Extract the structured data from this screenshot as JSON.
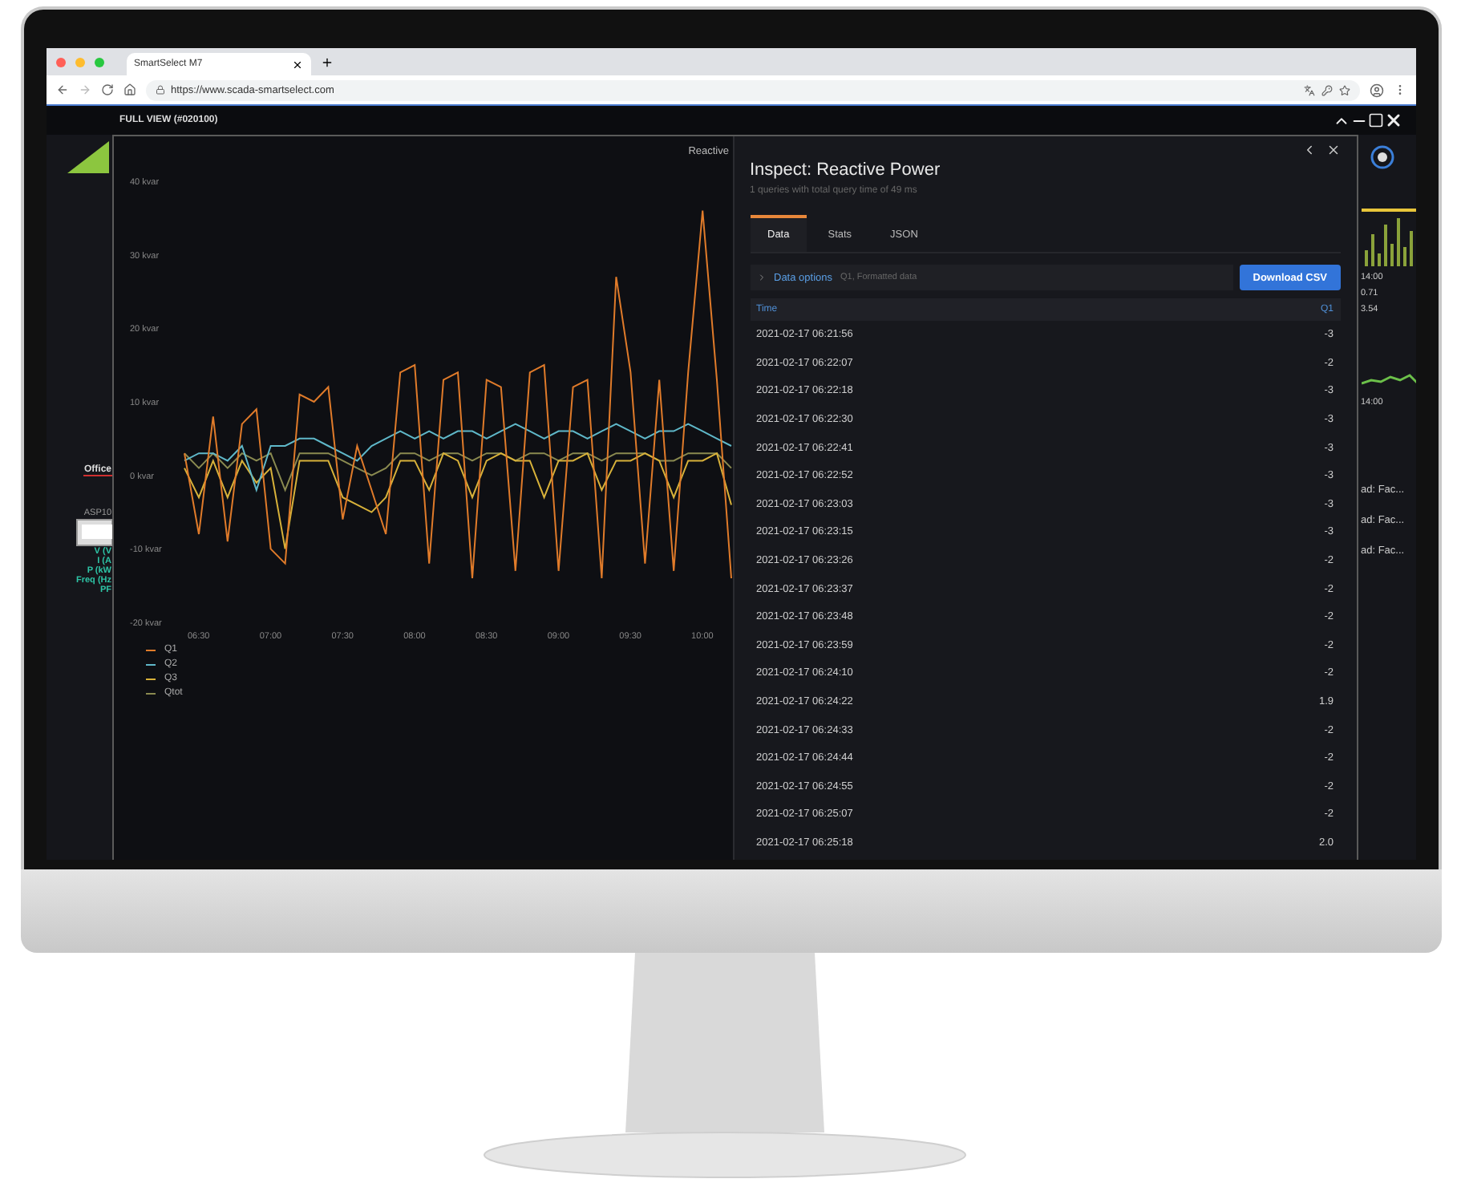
{
  "browser": {
    "tab_title": "SmartSelect M7",
    "url": "https://www.scada-smartselect.com"
  },
  "app_bar": {
    "title": "FULL VIEW (#020100)"
  },
  "left_fragments": {
    "nav_label": "Office",
    "device_label": "ASP10",
    "readings": [
      "V (V",
      "I (A",
      "P (kW",
      "Freq (Hz",
      "PF"
    ]
  },
  "chart": {
    "chart_data": {
      "type": "line",
      "title": "Reactive",
      "categories": [
        null,
        "06:30",
        null,
        null,
        null,
        null,
        "07:00",
        null,
        null,
        null,
        null,
        "07:30",
        null,
        null,
        null,
        null,
        "08:00",
        null,
        null,
        null,
        null,
        "08:30",
        null,
        null,
        null,
        null,
        "09:00",
        null,
        null,
        null,
        null,
        "09:30",
        null,
        null,
        null,
        null,
        "10:00",
        null,
        null
      ],
      "ylim": [
        -20,
        40
      ],
      "yticks": [
        {
          "value": 40,
          "label": "40 kvar"
        },
        {
          "value": 30,
          "label": "30 kvar"
        },
        {
          "value": 20,
          "label": "20 kvar"
        },
        {
          "value": 10,
          "label": "10 kvar"
        },
        {
          "value": 0,
          "label": "0 kvar"
        },
        {
          "value": -10,
          "label": "-10 kvar"
        },
        {
          "value": -20,
          "label": "-20 kvar"
        }
      ],
      "series": [
        {
          "name": "Q1",
          "color": "#e07b2a",
          "values": [
            3,
            -8,
            8,
            -9,
            7,
            9,
            -10,
            -12,
            11,
            10,
            12,
            -6,
            4,
            -2,
            -8,
            14,
            15,
            -12,
            13,
            14,
            -14,
            13,
            12,
            -13,
            14,
            15,
            -13,
            12,
            13,
            -14,
            27,
            14,
            -12,
            13,
            -13,
            14,
            36,
            13,
            -14
          ]
        },
        {
          "name": "Q2",
          "color": "#5fb8c9",
          "values": [
            2,
            3,
            3,
            2,
            4,
            -2,
            4,
            4,
            5,
            5,
            4,
            3,
            2,
            4,
            5,
            6,
            5,
            6,
            5,
            6,
            6,
            5,
            6,
            7,
            6,
            5,
            6,
            6,
            5,
            6,
            7,
            6,
            5,
            6,
            6,
            7,
            6,
            5,
            4
          ]
        },
        {
          "name": "Q3",
          "color": "#d8b23a",
          "values": [
            1,
            -3,
            2,
            -3,
            2,
            -1,
            1,
            -10,
            2,
            2,
            2,
            -3,
            -4,
            -5,
            -3,
            2,
            2,
            -2,
            3,
            2,
            -3,
            2,
            3,
            2,
            2,
            -3,
            2,
            2,
            3,
            -2,
            2,
            2,
            3,
            2,
            -3,
            2,
            2,
            3,
            -4
          ]
        },
        {
          "name": "Qtot",
          "color": "#8a8a50",
          "values": [
            3,
            1,
            3,
            1,
            3,
            2,
            3,
            -2,
            3,
            3,
            3,
            2,
            1,
            0,
            1,
            3,
            3,
            2,
            3,
            3,
            2,
            3,
            3,
            2,
            3,
            3,
            2,
            3,
            3,
            2,
            3,
            3,
            3,
            2,
            2,
            3,
            3,
            3,
            1
          ]
        }
      ]
    }
  },
  "inspect": {
    "title": "Inspect: Reactive Power",
    "subtitle": "1 queries with total query time of 49 ms",
    "tabs": [
      {
        "label": "Data",
        "selected": true
      },
      {
        "label": "Stats",
        "selected": false
      },
      {
        "label": "JSON",
        "selected": false
      }
    ],
    "data_options": {
      "label": "Data options",
      "summary": "Q1, Formatted data",
      "expanded": false
    },
    "download_button": "Download CSV",
    "table": {
      "columns": [
        "Time",
        "Q1"
      ],
      "rows": [
        [
          "2021-02-17 06:21:56",
          "-3"
        ],
        [
          "2021-02-17 06:22:07",
          "-2"
        ],
        [
          "2021-02-17 06:22:18",
          "-3"
        ],
        [
          "2021-02-17 06:22:30",
          "-3"
        ],
        [
          "2021-02-17 06:22:41",
          "-3"
        ],
        [
          "2021-02-17 06:22:52",
          "-3"
        ],
        [
          "2021-02-17 06:23:03",
          "-3"
        ],
        [
          "2021-02-17 06:23:15",
          "-3"
        ],
        [
          "2021-02-17 06:23:26",
          "-2"
        ],
        [
          "2021-02-17 06:23:37",
          "-2"
        ],
        [
          "2021-02-17 06:23:48",
          "-2"
        ],
        [
          "2021-02-17 06:23:59",
          "-2"
        ],
        [
          "2021-02-17 06:24:10",
          "-2"
        ],
        [
          "2021-02-17 06:24:22",
          "1.9"
        ],
        [
          "2021-02-17 06:24:33",
          "-2"
        ],
        [
          "2021-02-17 06:24:44",
          "-2"
        ],
        [
          "2021-02-17 06:24:55",
          "-2"
        ],
        [
          "2021-02-17 06:25:07",
          "-2"
        ],
        [
          "2021-02-17 06:25:18",
          "2.0"
        ]
      ]
    }
  },
  "right_fragments": {
    "time_a": "14:00",
    "values": [
      "0.71",
      "3.54"
    ],
    "time_b": "14:00",
    "items": [
      "ad: Fac...",
      "ad: Fac...",
      "ad: Fac..."
    ]
  }
}
